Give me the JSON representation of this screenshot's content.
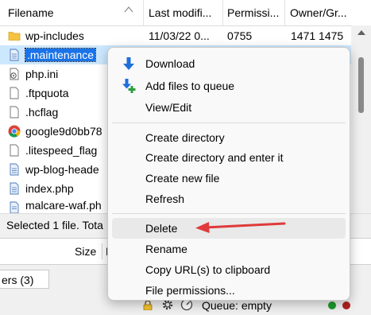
{
  "file_list": {
    "columns": [
      "Filename",
      "Last modifi...",
      "Permissi...",
      "Owner/Gr..."
    ],
    "rows": [
      {
        "icon": "folder-icon",
        "name": "wp-includes",
        "modified": "11/03/22 0...",
        "perms": "0755",
        "owner": "1471 1475"
      },
      {
        "icon": "text-file-icon",
        "name": ".maintenance",
        "modified": "",
        "perms": "",
        "owner": "",
        "selected": true
      },
      {
        "icon": "php-file-icon",
        "name": "php.ini",
        "modified": "",
        "perms": "",
        "owner": ""
      },
      {
        "icon": "blank-file-icon",
        "name": ".ftpquota",
        "modified": "",
        "perms": "",
        "owner": ""
      },
      {
        "icon": "blank-file-icon",
        "name": ".hcflag",
        "modified": "",
        "perms": "",
        "owner": ""
      },
      {
        "icon": "chrome-icon",
        "name": "google9d0bb78",
        "modified": "",
        "perms": "",
        "owner": ""
      },
      {
        "icon": "blank-file-icon",
        "name": ".litespeed_flag",
        "modified": "",
        "perms": "",
        "owner": ""
      },
      {
        "icon": "text-file-icon",
        "name": "wp-blog-heade",
        "modified": "",
        "perms": "",
        "owner": ""
      },
      {
        "icon": "text-file-icon",
        "name": "index.php",
        "modified": "",
        "perms": "",
        "owner": ""
      },
      {
        "icon": "text-file-icon",
        "name": "malcare-waf.ph",
        "modified": "",
        "perms": "",
        "owner": ""
      }
    ],
    "status_text": "Selected 1 file. Tota"
  },
  "queue": {
    "size_header": "Size",
    "priority_header": "P",
    "tab_label": "ers (3)",
    "status": "Queue: empty"
  },
  "context_menu": {
    "items": [
      {
        "label": "Download",
        "icon": "download-arrow-icon"
      },
      {
        "label": "Add files to queue",
        "icon": "add-to-queue-icon"
      },
      {
        "label": "View/Edit"
      },
      {
        "label": "Create directory"
      },
      {
        "label": "Create directory and enter it"
      },
      {
        "label": "Create new file"
      },
      {
        "label": "Refresh"
      },
      {
        "label": "Delete",
        "highlighted": true
      },
      {
        "label": "Rename"
      },
      {
        "label": "Copy URL(s) to clipboard"
      },
      {
        "label": "File permissions..."
      }
    ]
  },
  "colors": {
    "selection_bg": "#cce8ff",
    "selection_text_bg": "#1a73e8",
    "folder": "#f5c342",
    "download_arrow": "#1e6fd9",
    "queue_plus": "#2e9e3e",
    "annotation_arrow": "#e03a3a",
    "led_green": "#1f9a2e",
    "led_red": "#b02020"
  }
}
